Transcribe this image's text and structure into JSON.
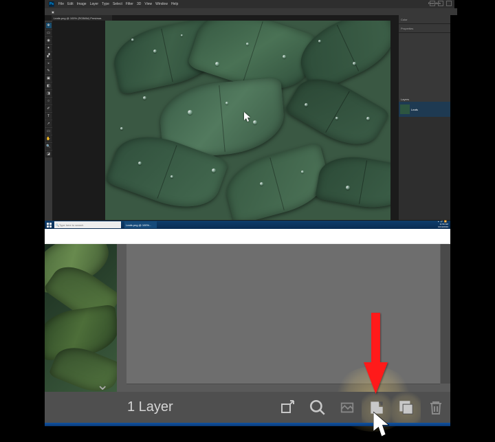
{
  "top": {
    "menu": [
      "File",
      "Edit",
      "Image",
      "Layer",
      "Type",
      "Select",
      "Filter",
      "3D",
      "View",
      "Window",
      "Help"
    ],
    "doc_tab": "Leafs.png @ 100% (RGB/8#) Previews",
    "top_right": [
      "Essentials"
    ],
    "panels": {
      "layers_header": "Layers",
      "layer_name": "Leafs"
    }
  },
  "taskbar": {
    "search_placeholder": "Type here to search",
    "app": "Leafs.png @ 100%...",
    "time": "11:50 AM",
    "date": "10/10/2019"
  },
  "bottom": {
    "layer_count": "1 Layer",
    "icons": {
      "export": "export-icon",
      "zoom": "zoom-icon",
      "compare": "compare-icon",
      "import": "import-icon",
      "copy": "copy-icon",
      "trash": "trash-icon"
    }
  },
  "annotation": {
    "arrow_color": "#ff1a1a"
  }
}
